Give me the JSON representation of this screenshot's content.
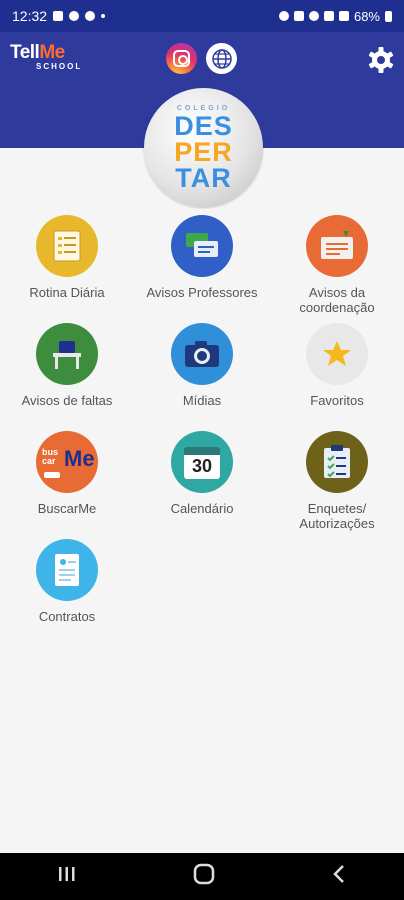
{
  "status_bar": {
    "time": "12:32",
    "battery": "68%"
  },
  "header": {
    "brand_top": "Tell",
    "brand_me": "Me",
    "brand_bottom": "SCHOOL",
    "icons": [
      "instagram-icon",
      "globe-icon",
      "gear-icon"
    ]
  },
  "logo": {
    "line0": "COLEGIO",
    "line1": "DES",
    "line2": "PER",
    "line3": "TAR"
  },
  "menu": [
    {
      "label": "Rotina Diária",
      "color": "#e8b82c"
    },
    {
      "label": "Avisos Professores",
      "color": "#2f5fc7"
    },
    {
      "label": "Avisos da coordenação",
      "color": "#e86a35"
    },
    {
      "label": "Avisos de faltas",
      "color": "#3e8d3e"
    },
    {
      "label": "Mídias",
      "color": "#2f8fd9"
    },
    {
      "label": "Favoritos",
      "color": "#e8e8e8"
    },
    {
      "label": "BuscarMe",
      "color": "#e86a35"
    },
    {
      "label": "Calendário",
      "color": "#2fa8a4"
    },
    {
      "label": "Enquetes/ Autorizações",
      "color": "#6e6119"
    },
    {
      "label": "Contratos",
      "color": "#3eb4e8"
    }
  ],
  "calendar_day": "30",
  "buscar_text": "bus car",
  "buscar_me": "Me"
}
